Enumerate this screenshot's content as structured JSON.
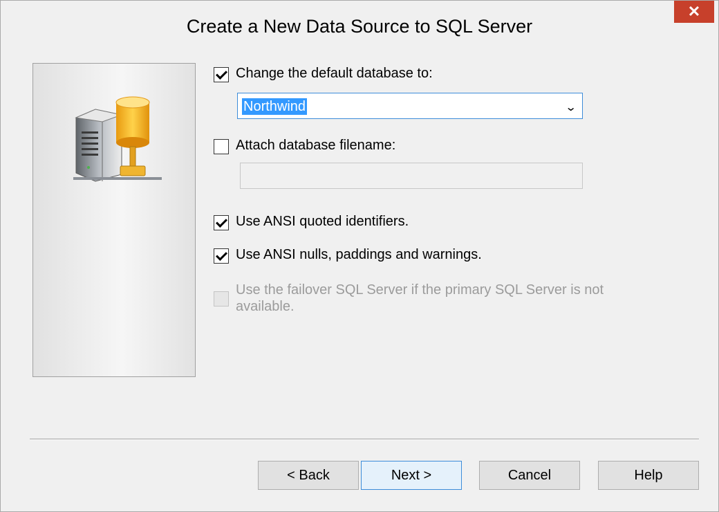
{
  "window": {
    "title": "Create a New Data Source to SQL Server",
    "close_label": "✕"
  },
  "options": {
    "change_default_db": {
      "label": "Change the default database to:",
      "checked": true
    },
    "default_db_value": "Northwind",
    "attach_filename": {
      "label": "Attach database filename:",
      "checked": false,
      "value": ""
    },
    "ansi_quoted": {
      "label": "Use ANSI quoted identifiers.",
      "checked": true
    },
    "ansi_nulls": {
      "label": "Use ANSI nulls, paddings and warnings.",
      "checked": true
    },
    "failover": {
      "label": "Use the failover SQL Server if the primary SQL Server is not available.",
      "checked": false,
      "disabled": true
    }
  },
  "buttons": {
    "back": "< Back",
    "next": "Next >",
    "cancel": "Cancel",
    "help": "Help"
  },
  "icons": {
    "server": "server-database-icon",
    "dropdown": "chevron-down-icon",
    "close": "close-icon"
  },
  "colors": {
    "close_bg": "#c7402b",
    "selection": "#3399ff",
    "focus_border": "#3c8cd9"
  }
}
